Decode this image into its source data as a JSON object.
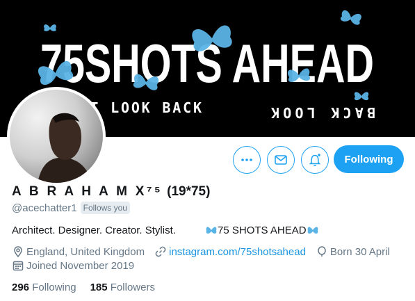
{
  "banner": {
    "headline": "75SHOTS AHEAD",
    "tagline": "DON'T LOOK BACK",
    "tagline_mirrored": "BACK LOOK"
  },
  "profile": {
    "name": "A B R A H A M X⁷⁵",
    "name_extra": "(19*75)",
    "handle": "@acechatter1",
    "follows_you": "Follows you",
    "bio_left": "Architect. Designer. Creator. Stylist.",
    "bio_right": "75 SHOTS AHEAD",
    "location": "England, United Kingdom",
    "website": "instagram.com/75shotsahead",
    "birthday": "Born 30 April",
    "joined": "Joined November 2019"
  },
  "actions": {
    "more_icon": "more-icon",
    "message_icon": "envelope-icon",
    "notify_icon": "bell-plus-icon",
    "follow_label": "Following"
  },
  "stats": {
    "following_count": "296",
    "following_label": "Following",
    "followers_count": "185",
    "followers_label": "Followers"
  },
  "colors": {
    "accent": "#1da1f2",
    "link": "#1b95e0",
    "muted": "#657786",
    "text": "#14171a",
    "butterfly": "#5ab4e6"
  }
}
